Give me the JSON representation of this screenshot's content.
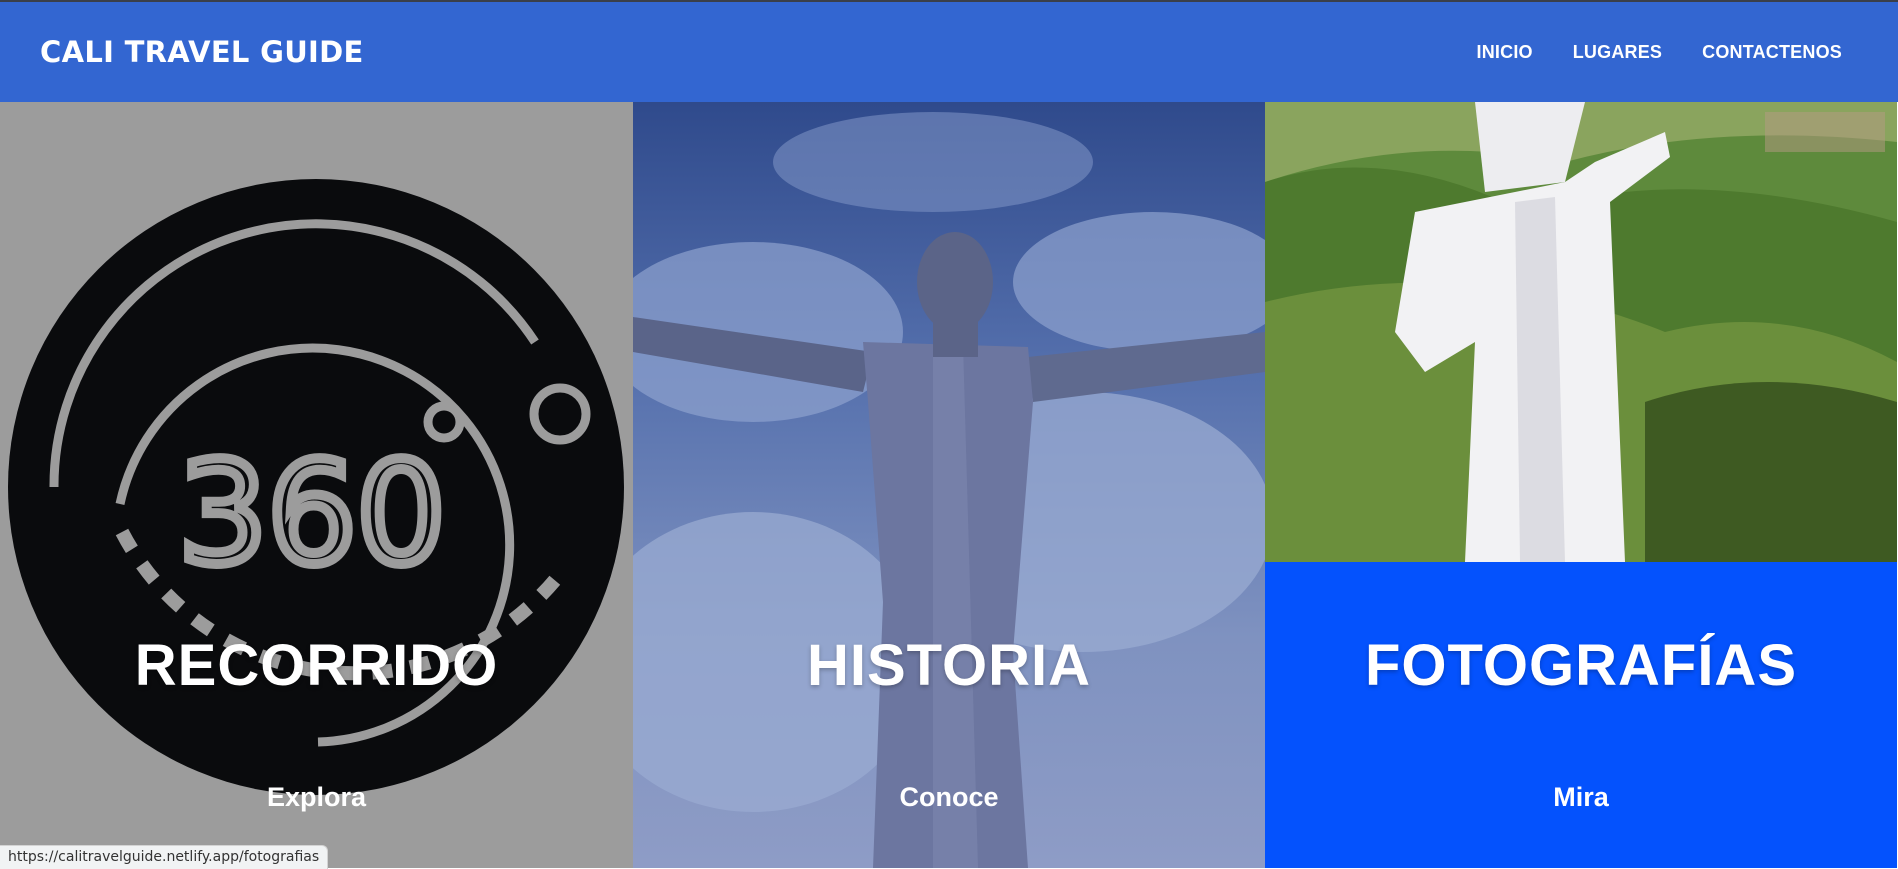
{
  "header": {
    "brand": "CALI TRAVEL GUIDE",
    "nav": [
      {
        "label": "INICIO"
      },
      {
        "label": "LUGARES"
      },
      {
        "label": "CONTACTENOS"
      }
    ]
  },
  "panels": [
    {
      "title": "RECORRIDO",
      "subtitle": "Explora",
      "icon": "360-degree-icon"
    },
    {
      "title": "HISTORIA",
      "subtitle": "Conoce",
      "image": "cristo-rey-statue-sky"
    },
    {
      "title": "FOTOGRAFÍAS",
      "subtitle": "Mira",
      "image": "cristo-rey-statue-hills"
    }
  ],
  "status_url": "https://calitravelguide.netlify.app/fotografias",
  "colors": {
    "navbar": "#3366d1",
    "panel_gray": "#9c9c9c",
    "panel_blue": "#0452fd"
  }
}
